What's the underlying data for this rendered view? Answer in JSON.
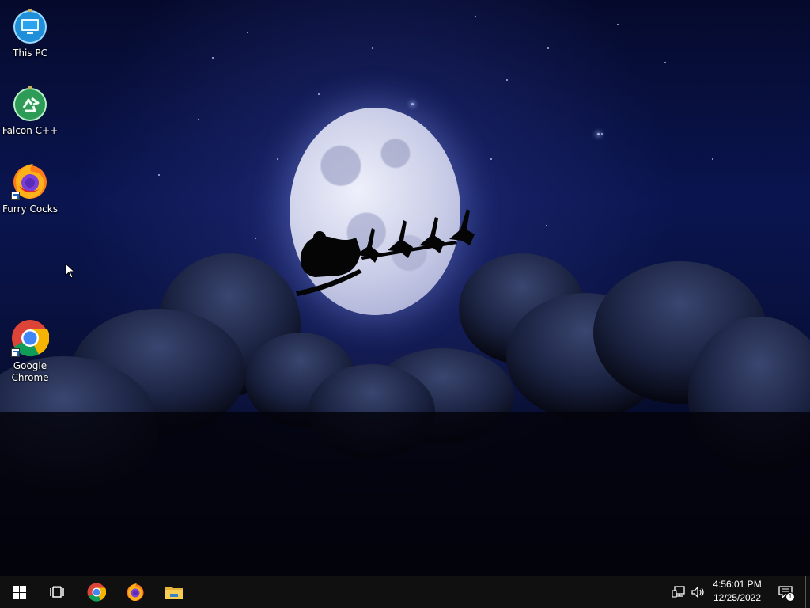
{
  "desktop": {
    "icons": [
      {
        "label": "This PC",
        "icon": "this-pc-icon"
      },
      {
        "label": "Falcon C++",
        "icon": "recycle-bin-icon"
      },
      {
        "label": "Furry Cocks",
        "icon": "firefox-icon"
      },
      {
        "label": "Google\nChrome",
        "icon": "chrome-icon"
      }
    ]
  },
  "taskbar": {
    "start_icon": "windows-logo-icon",
    "task_view_icon": "task-view-icon",
    "pinned": [
      {
        "name": "Google Chrome",
        "icon": "chrome-icon"
      },
      {
        "name": "Firefox",
        "icon": "firefox-icon"
      },
      {
        "name": "File Explorer",
        "icon": "folder-icon"
      }
    ],
    "tray": {
      "network_icon": "network-icon",
      "volume_icon": "volume-icon",
      "time": "4:56:01 PM",
      "date": "12/25/2022",
      "notification_count": "1"
    }
  },
  "colors": {
    "taskbar_bg": "#101010",
    "sky_top": "#050a2c",
    "accent_blue": "#1a62c6"
  }
}
